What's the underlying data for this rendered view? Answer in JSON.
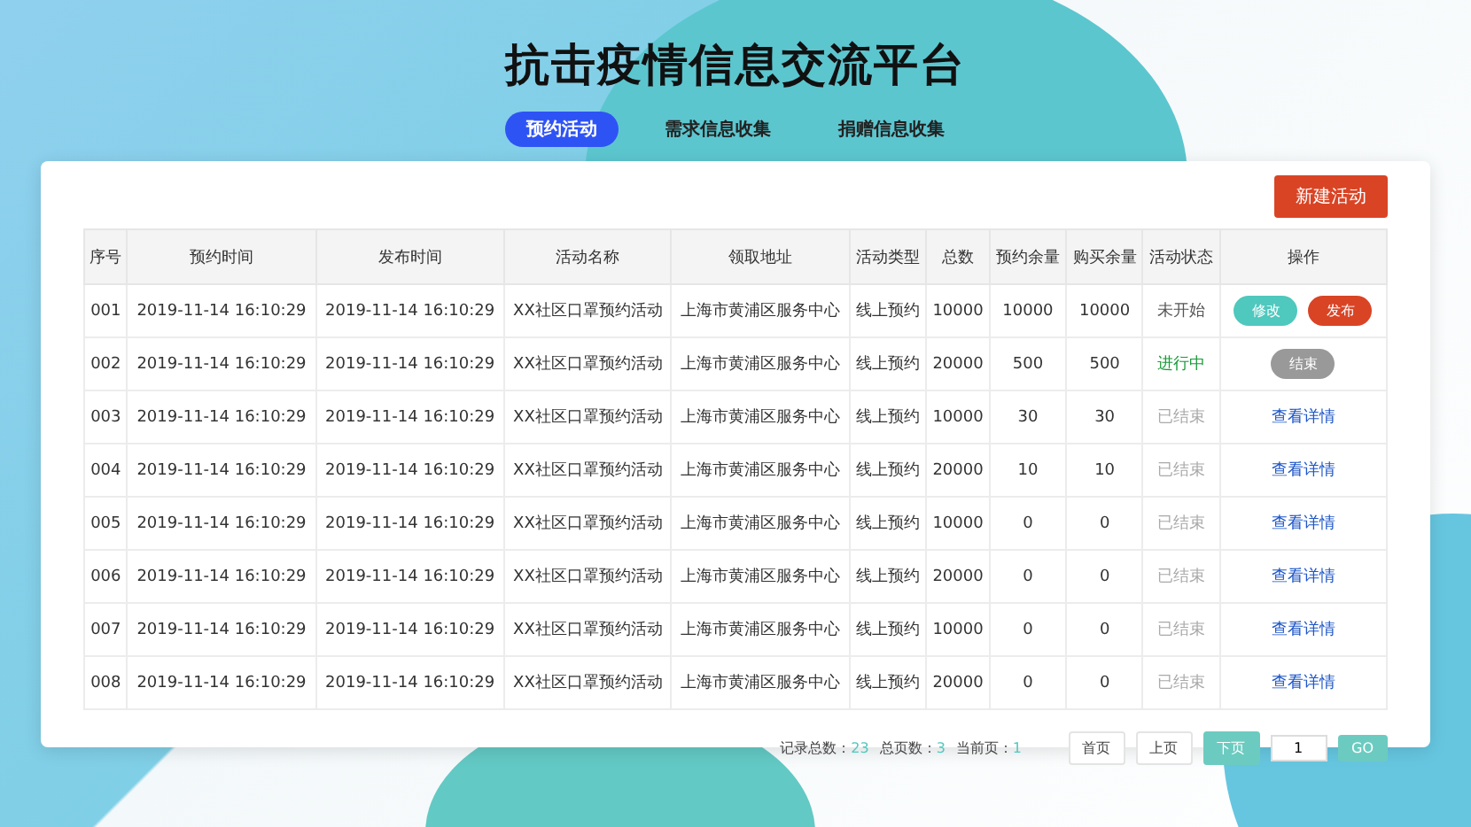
{
  "title": "抗击疫情信息交流平台",
  "tabs": [
    {
      "label": "预约活动",
      "selected": true
    },
    {
      "label": "需求信息收集",
      "selected": false
    },
    {
      "label": "捐赠信息收集",
      "selected": false
    }
  ],
  "new_button": "新建活动",
  "table": {
    "columns": [
      "序号",
      "预约时间",
      "发布时间",
      "活动名称",
      "领取地址",
      "活动类型",
      "总数",
      "预约余量",
      "购买余量",
      "活动状态",
      "操作"
    ],
    "rows": [
      {
        "cells": [
          "001",
          "2019-11-14  16:10:29",
          "2019-11-14  16:10:29",
          "XX社区口罩预约活动",
          "上海市黄浦区服务中心",
          "线上预约",
          "10000",
          "10000",
          "10000"
        ],
        "status": {
          "label": "未开始",
          "kind": "pending"
        },
        "actions": [
          {
            "label": "修改",
            "kind": "teal"
          },
          {
            "label": "发布",
            "kind": "red"
          }
        ]
      },
      {
        "cells": [
          "002",
          "2019-11-14  16:10:29",
          "2019-11-14  16:10:29",
          "XX社区口罩预约活动",
          "上海市黄浦区服务中心",
          "线上预约",
          "20000",
          "500",
          "500"
        ],
        "status": {
          "label": "进行中",
          "kind": "active"
        },
        "actions": [
          {
            "label": "结束",
            "kind": "grey"
          }
        ]
      },
      {
        "cells": [
          "003",
          "2019-11-14  16:10:29",
          "2019-11-14  16:10:29",
          "XX社区口罩预约活动",
          "上海市黄浦区服务中心",
          "线上预约",
          "10000",
          "30",
          "30"
        ],
        "status": {
          "label": "已结束",
          "kind": "ended"
        },
        "actions": [
          {
            "label": "查看详情",
            "kind": "link"
          }
        ]
      },
      {
        "cells": [
          "004",
          "2019-11-14  16:10:29",
          "2019-11-14  16:10:29",
          "XX社区口罩预约活动",
          "上海市黄浦区服务中心",
          "线上预约",
          "20000",
          "10",
          "10"
        ],
        "status": {
          "label": "已结束",
          "kind": "ended"
        },
        "actions": [
          {
            "label": "查看详情",
            "kind": "link"
          }
        ]
      },
      {
        "cells": [
          "005",
          "2019-11-14  16:10:29",
          "2019-11-14  16:10:29",
          "XX社区口罩预约活动",
          "上海市黄浦区服务中心",
          "线上预约",
          "10000",
          "0",
          "0"
        ],
        "status": {
          "label": "已结束",
          "kind": "ended"
        },
        "actions": [
          {
            "label": "查看详情",
            "kind": "link"
          }
        ]
      },
      {
        "cells": [
          "006",
          "2019-11-14  16:10:29",
          "2019-11-14  16:10:29",
          "XX社区口罩预约活动",
          "上海市黄浦区服务中心",
          "线上预约",
          "20000",
          "0",
          "0"
        ],
        "status": {
          "label": "已结束",
          "kind": "ended"
        },
        "actions": [
          {
            "label": "查看详情",
            "kind": "link"
          }
        ]
      },
      {
        "cells": [
          "007",
          "2019-11-14  16:10:29",
          "2019-11-14  16:10:29",
          "XX社区口罩预约活动",
          "上海市黄浦区服务中心",
          "线上预约",
          "10000",
          "0",
          "0"
        ],
        "status": {
          "label": "已结束",
          "kind": "ended"
        },
        "actions": [
          {
            "label": "查看详情",
            "kind": "link"
          }
        ]
      },
      {
        "cells": [
          "008",
          "2019-11-14  16:10:29",
          "2019-11-14  16:10:29",
          "XX社区口罩预约活动",
          "上海市黄浦区服务中心",
          "线上预约",
          "20000",
          "0",
          "0"
        ],
        "status": {
          "label": "已结束",
          "kind": "ended"
        },
        "actions": [
          {
            "label": "查看详情",
            "kind": "link"
          }
        ]
      }
    ]
  },
  "pagination": {
    "stats": [
      {
        "label": "记录总数：",
        "value": "23"
      },
      {
        "label": "总页数：",
        "value": "3"
      },
      {
        "label": "当前页：",
        "value": "1"
      }
    ],
    "buttons": [
      {
        "label": "首页",
        "kind": "plain"
      },
      {
        "label": "上页",
        "kind": "plain"
      },
      {
        "label": "下页",
        "kind": "teal"
      }
    ],
    "page_input": "1",
    "go": "GO"
  }
}
